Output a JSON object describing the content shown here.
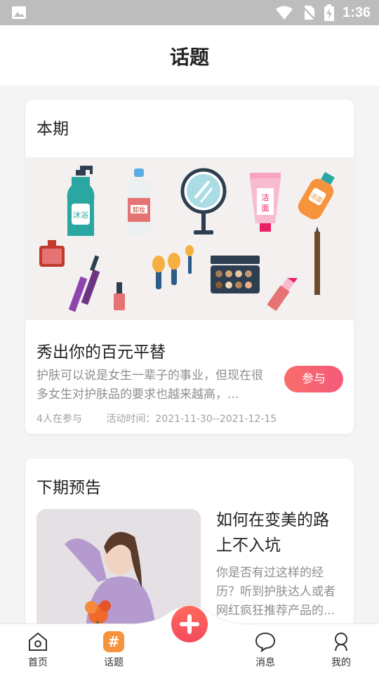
{
  "status_bar": {
    "time": "1:36",
    "icons": [
      "image-icon",
      "wifi-icon",
      "no-sim-icon",
      "battery-charging-icon"
    ]
  },
  "header": {
    "title": "话题"
  },
  "current": {
    "section_title": "本期",
    "product_labels": [
      "沐浴",
      "卸妆",
      "洁面",
      "洁面"
    ],
    "topic_title": "秀出你的百元平替",
    "description": "护肤可以说是女生一辈子的事业，但现在很多女生对护肤品的要求也越来越高，...",
    "join_label": "参与",
    "participants": "4人在参与",
    "activity_time": "活动时间：2021-11-30--2021-12-15"
  },
  "next": {
    "section_title": "下期预告",
    "title": "如何在变美的路上不入坑",
    "description": "你是否有过这样的经历？听到护肤达人或者网红疯狂推荐产品的..."
  },
  "tab_bar": {
    "home": "首页",
    "topic": "话题",
    "topic_symbol": "#",
    "message": "消息",
    "me": "我的",
    "active": "topic"
  },
  "colors": {
    "accent": "#f7933d",
    "join_gradient_start": "#f96d68",
    "join_gradient_end": "#f55a7a",
    "add_button": "#f44a5e"
  }
}
